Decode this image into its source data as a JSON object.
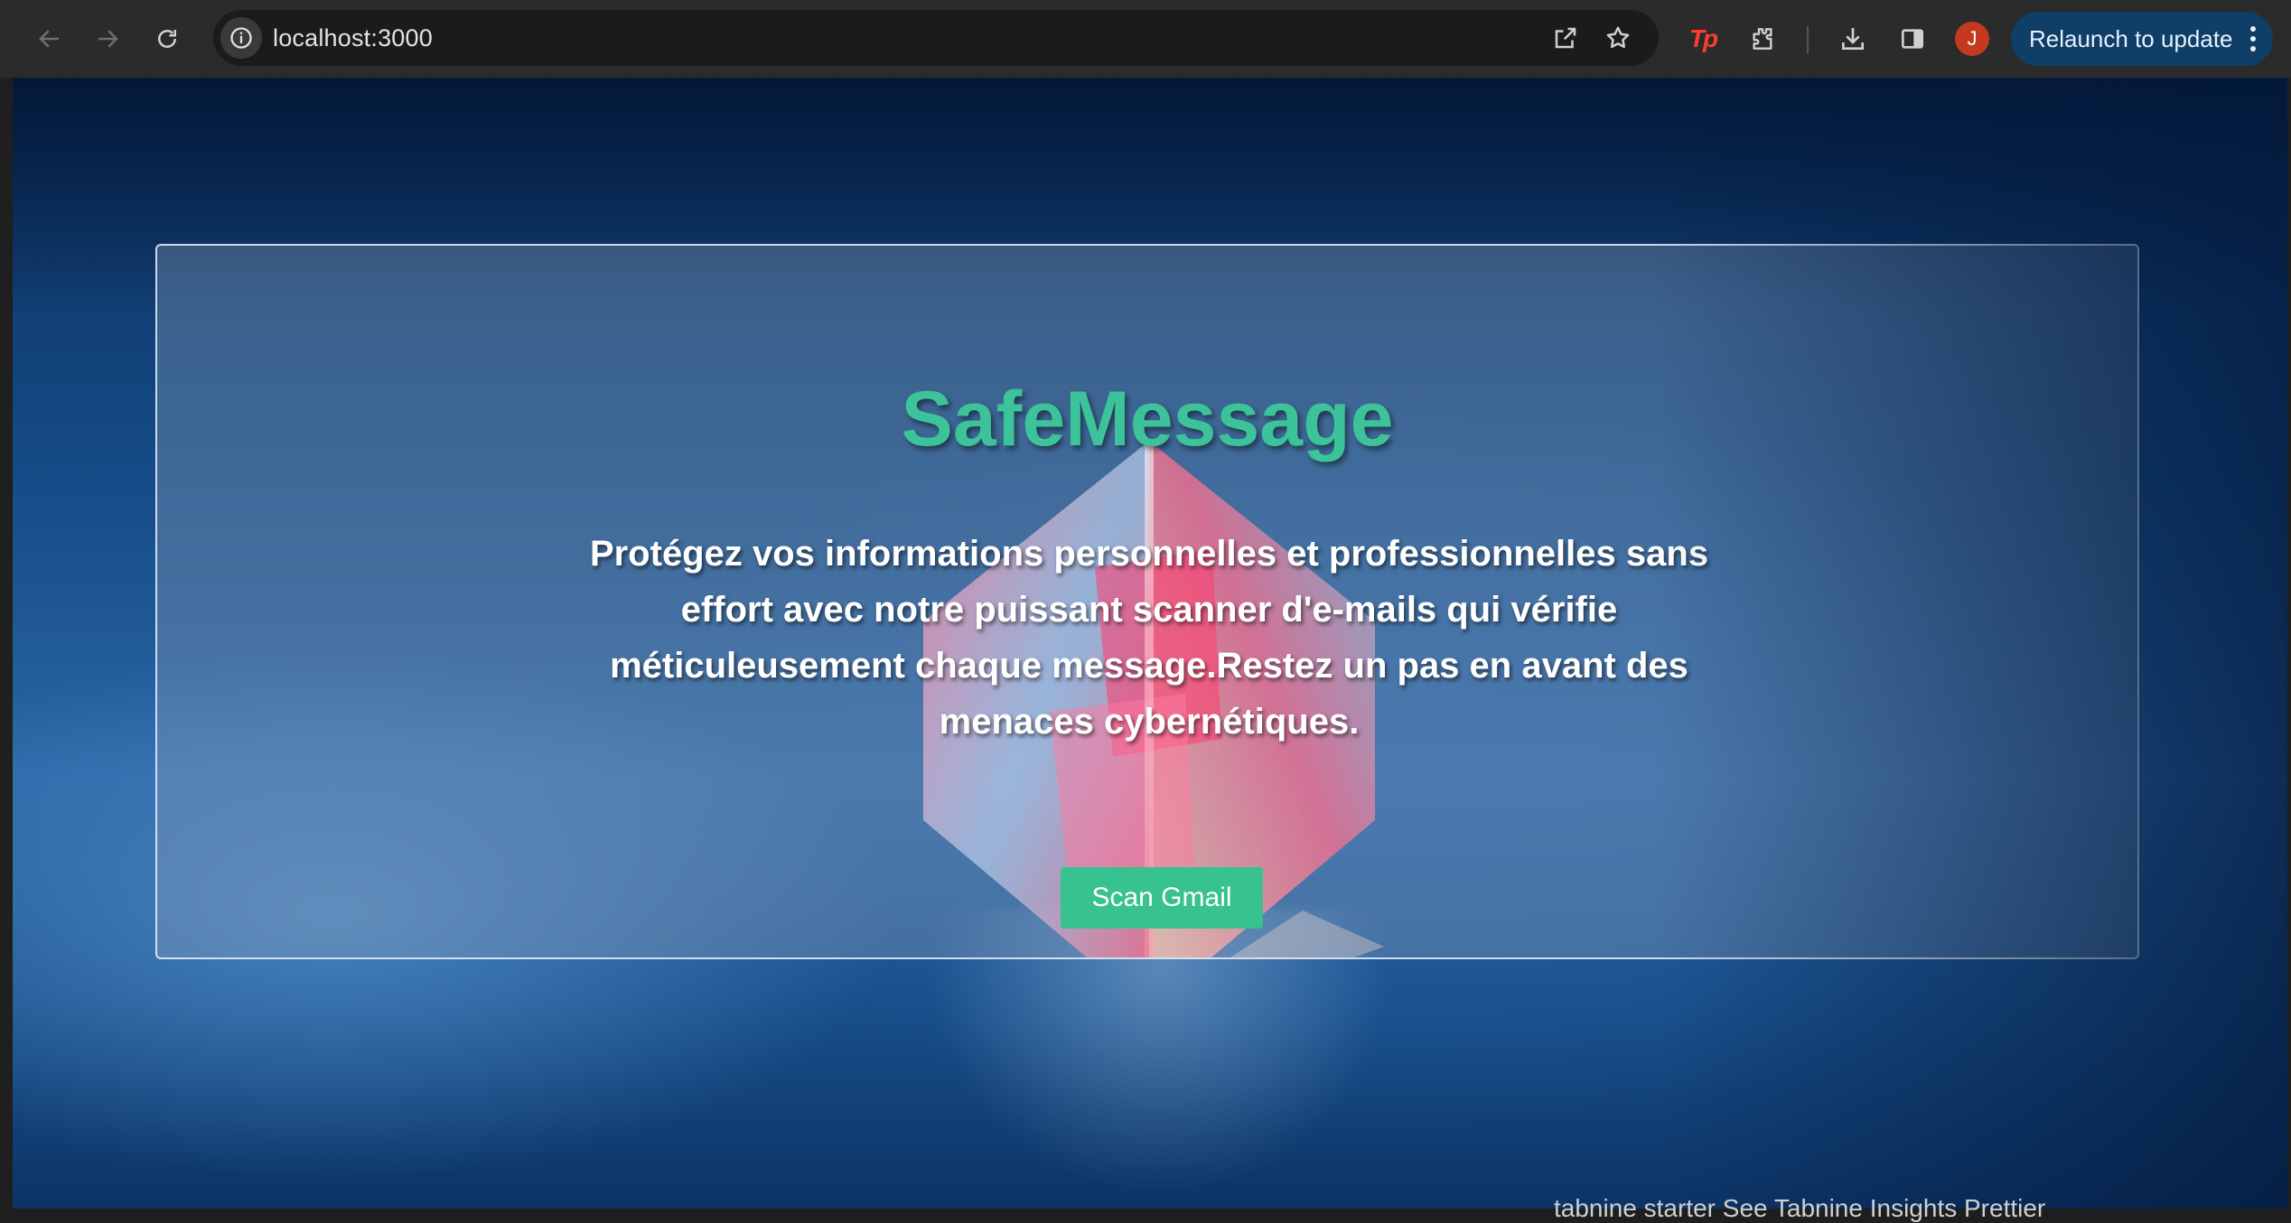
{
  "browser": {
    "url": "localhost:3000",
    "relaunch_label": "Relaunch to update",
    "avatar_letter": "J",
    "extension_logo_text": "Tp"
  },
  "page": {
    "title": "SafeMessage",
    "description": "Protégez vos informations personnelles et professionnelles sans effort avec notre puissant scanner d'e-mails qui vérifie méticuleusement chaque message.Restez un pas en avant des menaces cybernétiques.",
    "scan_button_label": "Scan Gmail"
  },
  "taskbar": {
    "partial_text": "tabnine starter    See Tabnine Insights    Prettier"
  },
  "colors": {
    "accent_green": "#37c28f",
    "title_green": "#3cc39a",
    "relaunch_bg": "#0f3e66",
    "avatar_bg": "#c5391f"
  }
}
